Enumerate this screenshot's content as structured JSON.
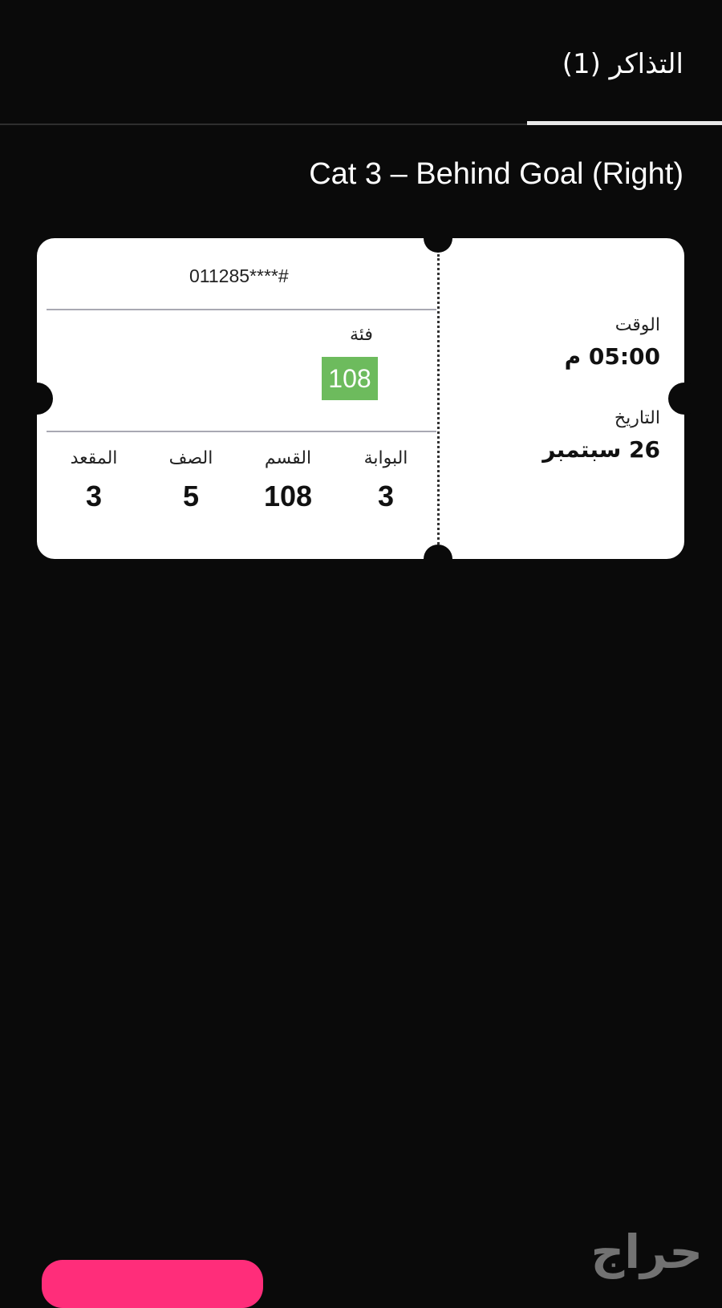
{
  "header": {
    "tab_label": "التذاكر (1)"
  },
  "ticket": {
    "title": "Cat 3 – Behind Goal (Right)",
    "number": "011285****#",
    "category_label": "فئة",
    "category_value": "108",
    "gate_label": "البوابة",
    "gate_value": "3",
    "section_label": "القسم",
    "section_value": "108",
    "row_label": "الصف",
    "row_value": "5",
    "seat_label": "المقعد",
    "seat_value": "3",
    "time_label": "الوقت",
    "time_value": "05:00 م",
    "date_label": "التاريخ",
    "date_value": "26 سبتمبر"
  },
  "watermark": "حراج",
  "colors": {
    "background": "#0a0a0a",
    "badge": "#6dbb5d",
    "button": "#ff2d7a"
  }
}
